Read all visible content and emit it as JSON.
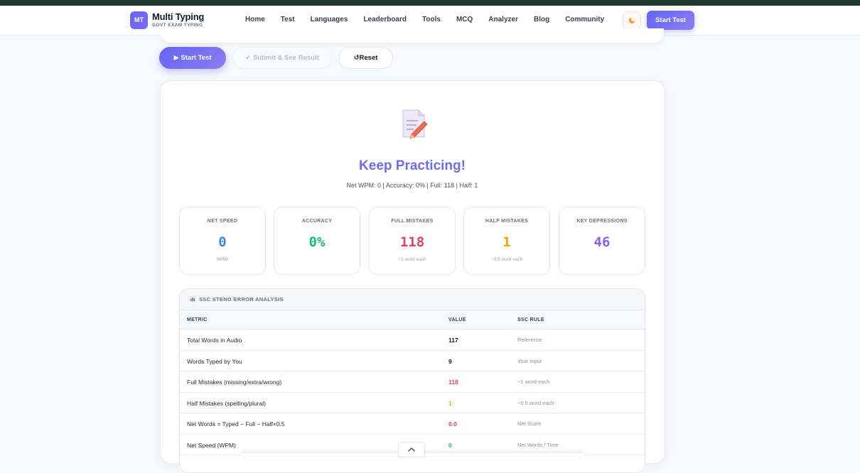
{
  "header": {
    "logo_badge": "MT",
    "logo_title": "Multi Typing",
    "logo_subtitle": "GOVT EXAM TYPING",
    "nav": [
      "Home",
      "Test",
      "Languages",
      "Leaderboard",
      "Tools",
      "MCQ",
      "Analyzer",
      "Blog",
      "Community"
    ],
    "theme_icon": "moon-icon",
    "start_label": "Start Test"
  },
  "actions": {
    "start": "▶ Start Test",
    "submit": "✔ Submit & See Result",
    "reset": "↺Reset"
  },
  "result": {
    "icon": "document-pencil-icon",
    "title": "Keep Practicing!",
    "summary": "Net WPM: 0 | Accuracy: 0% | Full: 118 | Half: 1"
  },
  "stats": [
    {
      "label": "NET SPEED",
      "value": "0",
      "note": "WPM",
      "color": "#3b82f6"
    },
    {
      "label": "ACCURACY",
      "value": "0%",
      "note": "",
      "color": "#10b981"
    },
    {
      "label": "FULL MISTAKES",
      "value": "118",
      "note": "−1 word each",
      "color": "#e0445e"
    },
    {
      "label": "HALF MISTAKES",
      "value": "1",
      "note": "−0.5 word each",
      "color": "#f59e0b"
    },
    {
      "label": "KEY DEPRESSIONS",
      "value": "46",
      "note": "",
      "color": "#8b5cf6"
    }
  ],
  "analysis": {
    "title": "SSC STENO ERROR ANALYSIS",
    "columns": [
      "METRIC",
      "VALUE",
      "SSC RULE"
    ],
    "rows": [
      {
        "metric": "Total Words in Audio",
        "value": "117",
        "rule": "Reference",
        "color": "#111827"
      },
      {
        "metric": "Words Typed by You",
        "value": "9",
        "rule": "Your Input",
        "color": "#111827"
      },
      {
        "metric": "Full Mistakes (missing/extra/wrong)",
        "value": "118",
        "rule": "−1 word each",
        "color": "#e0445e"
      },
      {
        "metric": "Half Mistakes (spelling/plural)",
        "value": "1",
        "rule": "−0.5 word each",
        "color": "#f59e0b"
      },
      {
        "metric": "Net Words = Typed − Full − Half×0.5",
        "value": "0.0",
        "rule": "Net Score",
        "color": "#e0445e"
      },
      {
        "metric": "Net Speed (WPM)",
        "value": "0",
        "rule": "Net Words / Time",
        "color": "#10b981"
      }
    ]
  },
  "colors": {
    "accent": "#6366f1"
  }
}
